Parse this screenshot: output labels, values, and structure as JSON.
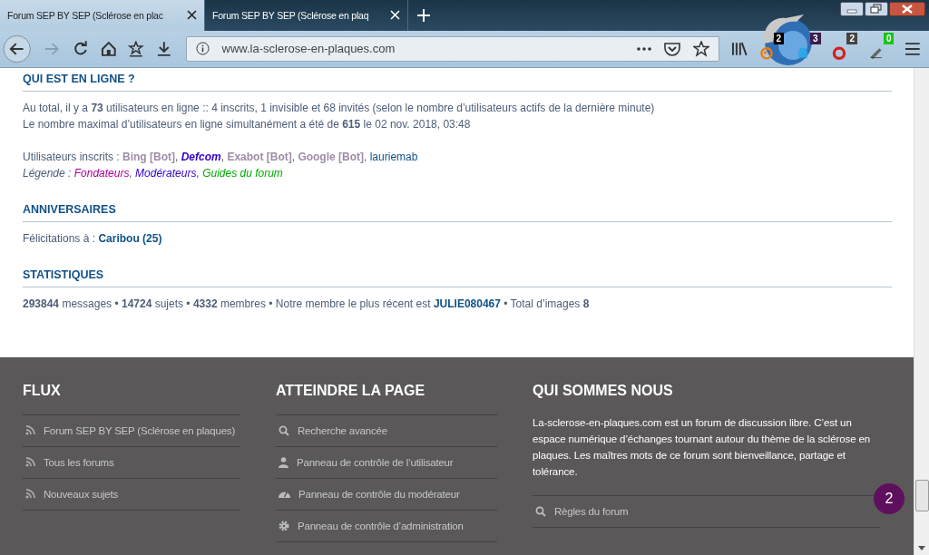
{
  "browser": {
    "tabs": [
      {
        "title": "Forum SEP BY SEP (Sclérose en plac",
        "selected": true
      },
      {
        "title": "Forum SEP BY SEP (Sclérose en plaq",
        "selected": false
      }
    ],
    "url": "www.la-sclerose-en-plaques.com",
    "extensions": [
      {
        "kind": "orange",
        "badge": "2",
        "color": "#000000"
      },
      {
        "kind": "ghost",
        "badge": "3",
        "color": "#3a1d4f"
      },
      {
        "kind": "stop",
        "badge": "2",
        "color": "#444444"
      },
      {
        "kind": "pen",
        "badge": "0",
        "color": "#19c419"
      }
    ]
  },
  "online": {
    "heading": "QUI EST EN LIGNE ?",
    "lines": [
      "Au total, il y a **73** utilisateurs en ligne :: 4 inscrits, 1 invisible et 68 invités (selon le nombre d’utilisateurs actifs de la dernière minute)",
      "Le nombre maximal d’utilisateurs en ligne simultanément a été de **615** le 02 nov. 2018, 03:48"
    ],
    "users_label": "Utilisateurs inscrits : ",
    "separator": ", ",
    "users": [
      {
        "name": "Bing [Bot]",
        "kind": "bot",
        "color": "#9e8da7"
      },
      {
        "name": "Defcom",
        "kind": "moderator",
        "color": "#3300cc"
      },
      {
        "name": "Exabot [Bot]",
        "kind": "bot",
        "color": "#9e8da7"
      },
      {
        "name": "Google [Bot]",
        "kind": "bot",
        "color": "#9e8da7"
      },
      {
        "name": "lauriemab",
        "kind": "member",
        "color": "#105289"
      }
    ],
    "legend_label": "Légende : ",
    "legend": [
      {
        "name": "Fondateurs",
        "color": "#aa0099"
      },
      {
        "name": "Modérateurs",
        "color": "#3300cc"
      },
      {
        "name": "Guides du forum",
        "color": "#00aa00"
      }
    ]
  },
  "birthdays": {
    "heading": "ANNIVERSAIRES",
    "label": "Félicitations à : ",
    "name": "Caribou (25)"
  },
  "stats": {
    "heading": "STATISTIQUES",
    "text": "**293844** messages • **14724** sujets • **4332** membres • Notre membre le plus récent est ",
    "newest": "JULIE080467",
    "tail": " • Total d’images **8**"
  },
  "footer": {
    "columns": [
      {
        "heading": "FLUX",
        "items": [
          {
            "kind": "rss",
            "label": "Forum SEP BY SEP (Sclérose en plaques)"
          },
          {
            "kind": "rss",
            "label": "Tous les forums"
          },
          {
            "kind": "rss",
            "label": "Nouveaux sujets"
          }
        ]
      },
      {
        "heading": "ATTEINDRE LA PAGE",
        "items": [
          {
            "kind": "search",
            "label": "Recherche avancée"
          },
          {
            "kind": "user",
            "label": "Panneau de contrôle de l’utilisateur"
          },
          {
            "kind": "gauge",
            "label": "Panneau de contrôle du modérateur"
          },
          {
            "kind": "gear",
            "label": "Panneau de contrôle d’administration"
          }
        ]
      },
      {
        "heading": "QUI SOMMES NOUS",
        "text": "La-sclerose-en-plaques.com est un forum de discussion libre. C’est un espace numérique d’échanges tournant autour du thème de la sclérose en plaques. Les maîtres mots de ce forum sont bienveillance, partage et tolérance.",
        "items": [
          {
            "kind": "search",
            "label": "Règles du forum"
          }
        ]
      }
    ]
  },
  "notification_count": "2"
}
